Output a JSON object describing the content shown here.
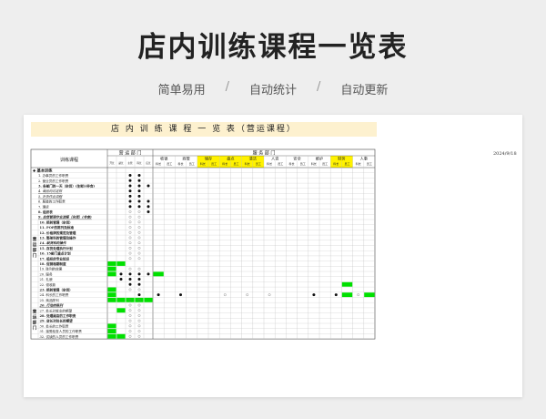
{
  "header": {
    "title": "店内训练课程一览表",
    "features": [
      "简单易用",
      "自动统计",
      "自动更新"
    ],
    "separator": "/"
  },
  "sheet": {
    "title": "店 内 训 练 课 程 一 览 表（营运课程）",
    "date": "2024/9/18",
    "course_header": "训练课程",
    "group_ops": "营 运 部 门",
    "group_service": "服 务 部 门",
    "ops_cols": [
      "开长",
      "副长",
      "主管/科长",
      "科长",
      "店长/培训专员"
    ],
    "service_depts": [
      {
        "name": "收银",
        "hl": false
      },
      {
        "name": "商管",
        "hl": false
      },
      {
        "name": "储存",
        "hl": true
      },
      {
        "name": "盘点",
        "hl": true
      },
      {
        "name": "清洁",
        "hl": true
      },
      {
        "name": "人资",
        "hl": false
      },
      {
        "name": "安全",
        "hl": false
      },
      {
        "name": "维护",
        "hl": false
      },
      {
        "name": "财务",
        "hl": true
      },
      {
        "name": "人事",
        "hl": false
      }
    ],
    "sub_roles": [
      "科长",
      "员工"
    ],
    "category_basic": "◆ 基本训练",
    "side_label_1": "营运部门",
    "side_label_2": "营运部门",
    "rows": [
      {
        "label": "1. 办事员的工作职责",
        "b": false
      },
      {
        "label": "2. 营业员的工作职责",
        "b": false
      },
      {
        "label": "3. 各部门的一天（杂货）(生鲜)(非食)",
        "b": true
      },
      {
        "label": "4. 商品的过定取",
        "b": false,
        "u": true
      },
      {
        "label": "5. 补货作业流程",
        "b": false,
        "u": true
      },
      {
        "label": "6. 服装的工作职责",
        "b": false
      },
      {
        "label": "7. 理货",
        "b": false
      },
      {
        "label": "8. 组织表",
        "b": true
      },
      {
        "label": "9. 自然管理作业流程（杂货）(非食)",
        "b": true,
        "u": true
      },
      {
        "label": "10. 损耗管理（杂货）",
        "b": true
      },
      {
        "label": "11. POP的陈列及标准",
        "b": true
      },
      {
        "label": "12. 价格牌的规范及管理",
        "b": true
      },
      {
        "label": "13. 整架科的管理及操作",
        "b": true
      },
      {
        "label": "14. 缺货科的操作",
        "b": true,
        "u": true
      },
      {
        "label": "15. 存货处理执行计划",
        "b": true
      },
      {
        "label": "16. 15部门重点计划",
        "b": true
      },
      {
        "label": "17. 组织的专业知识",
        "b": true
      },
      {
        "label": "18. 促销档期制度",
        "b": true
      },
      {
        "label": "19. 陈列的效果",
        "b": false
      },
      {
        "label": "20. 服务",
        "b": false
      },
      {
        "label": "21. 礼貌",
        "b": false
      },
      {
        "label": "22. 领收款",
        "b": false
      },
      {
        "label": "23. 损耗管理（杂货）",
        "b": true
      },
      {
        "label": "24. 科长的工作职责",
        "b": false
      },
      {
        "label": "25. 商品陈列",
        "b": false
      },
      {
        "label": "26. 行动的陈列",
        "b": true,
        "u": true
      },
      {
        "label": "27. 处长对就业的期望",
        "b": false
      },
      {
        "label": "28. 处理副店的工作职责",
        "b": true
      },
      {
        "label": "29. 店长对处长的期望",
        "b": true
      },
      {
        "label": "30. 处长的工作职责",
        "b": false
      },
      {
        "label": "31. 接受检查人员的工作职责",
        "b": false
      },
      {
        "label": "32. 试读的人员的工作职责",
        "b": false
      }
    ],
    "marks": {
      "filled": "●",
      "hollow": "○"
    }
  },
  "colors": {
    "accent_yellow": "#fdf1cf",
    "highlight_yellow": "#fff200",
    "green": "#00e000",
    "grid_line": "#bbbbbb",
    "border": "#444444"
  }
}
